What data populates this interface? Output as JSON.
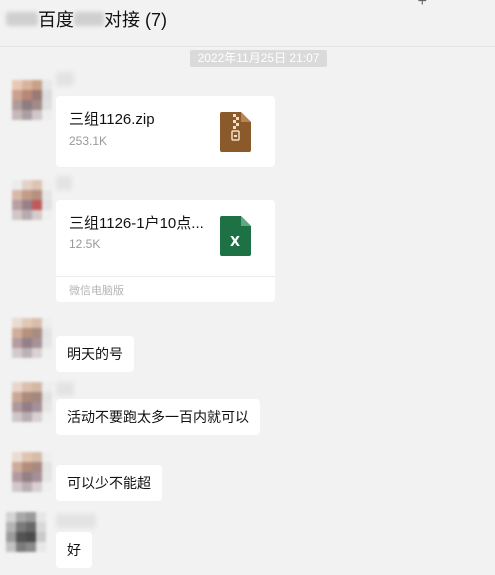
{
  "header": {
    "title_part1": "百度",
    "title_part2": "对接 (7)",
    "add_icon": "plus-icon"
  },
  "timestamp": "2022年11月25日 21:07",
  "messages": [
    {
      "type": "file",
      "file_name": "三组1126.zip",
      "file_size": "253.1K",
      "icon": "zip-file-icon",
      "icon_color": "#8b5a2b"
    },
    {
      "type": "file",
      "file_name": "三组1126-1户10点...",
      "file_size": "12.5K",
      "icon": "excel-file-icon",
      "icon_color": "#1e7145",
      "source": "微信电脑版"
    },
    {
      "type": "text",
      "text": "明天的号"
    },
    {
      "type": "text",
      "text": "活动不要跑太多一百内就可以"
    },
    {
      "type": "text",
      "text": "可以少不能超"
    },
    {
      "type": "text",
      "text": "好"
    }
  ]
}
